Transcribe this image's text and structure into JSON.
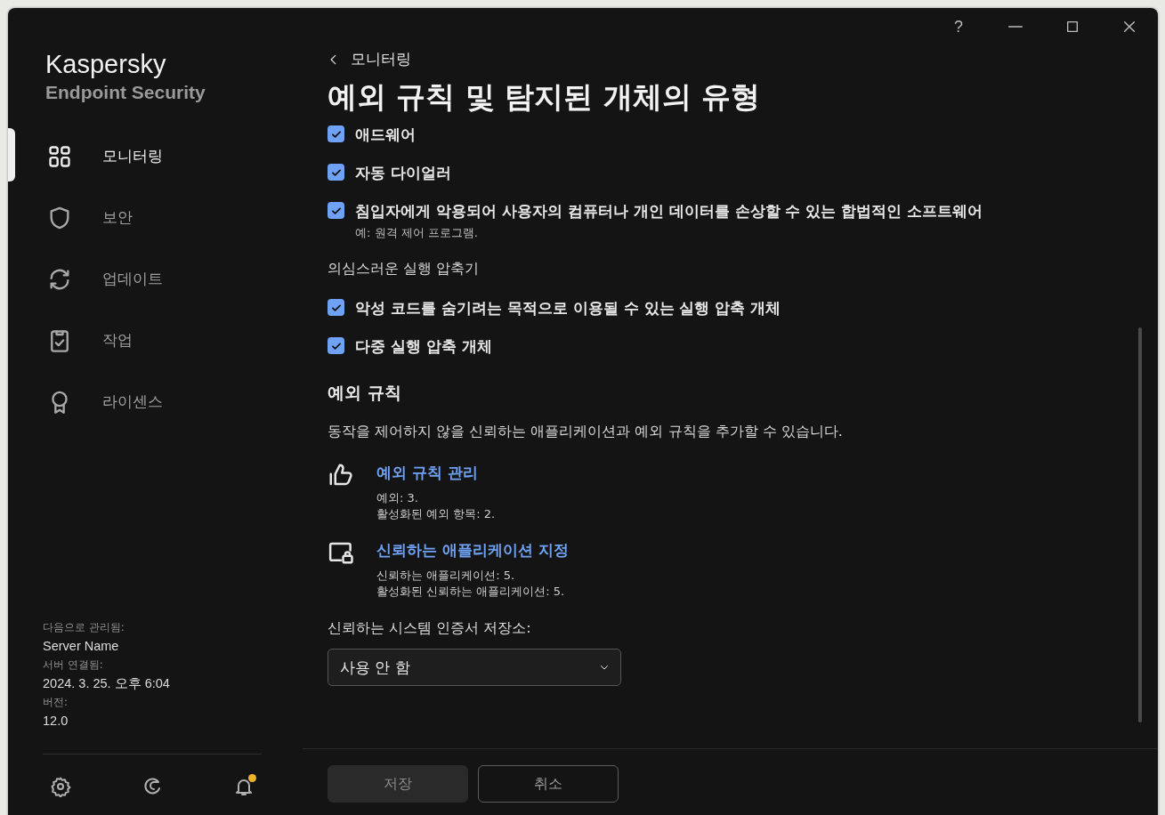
{
  "window": {
    "help": "?"
  },
  "sidebar": {
    "brand": {
      "name": "Kaspersky",
      "product": "Endpoint Security"
    },
    "items": [
      {
        "label": "모니터링",
        "selected": true
      },
      {
        "label": "보안",
        "selected": false
      },
      {
        "label": "업데이트",
        "selected": false
      },
      {
        "label": "작업",
        "selected": false
      },
      {
        "label": "라이센스",
        "selected": false
      }
    ],
    "info": [
      {
        "label": "다음으로 관리됨:",
        "value": "Server Name"
      },
      {
        "label": "서버 연결됨:",
        "value": "2024. 3. 25. 오후 6:04"
      },
      {
        "label": "버전:",
        "value": "12.0"
      }
    ],
    "notifications": {
      "unread": true
    }
  },
  "header": {
    "back": "모니터링",
    "title": "예외 규칙 및 탐지된 개체의 유형"
  },
  "content": [
    {
      "kind": "checkbox",
      "label": "애드웨어",
      "checked": true
    },
    {
      "kind": "checkbox",
      "label": "자동 다이얼러",
      "checked": true
    },
    {
      "kind": "checkbox",
      "label": "침입자에게 악용되어 사용자의 컴퓨터나 개인 데이터를 손상할 수 있는 합법적인 소프트웨어",
      "checked": true,
      "note": "예: 원격 제어 프로그램."
    },
    {
      "kind": "group",
      "label": "의심스러운 실행 압축기"
    },
    {
      "kind": "checkbox",
      "label": "악성 코드를 숨기려는 목적으로 이용될 수 있는 실행 압축 개체",
      "checked": true
    },
    {
      "kind": "checkbox",
      "label": "다중 실행 압축 개체",
      "checked": true
    },
    {
      "kind": "section",
      "label": "예외 규칙"
    },
    {
      "kind": "text",
      "label": "동작을 제어하지 않을 신뢰하는 애플리케이션과 예외 규칙을 추가할 수 있습니다."
    },
    {
      "kind": "link",
      "label": "예외 규칙 관리",
      "lines": [
        "예외: 3.",
        "활성화된 예외 항목: 2."
      ]
    },
    {
      "kind": "link",
      "label": "신뢰하는 애플리케이션 지정",
      "lines": [
        "신뢰하는 애플리케이션: 5.",
        "활성화된 신뢰하는 애플리케이션: 5."
      ]
    },
    {
      "kind": "select",
      "label": "신뢰하는 시스템 인증서 저장소:",
      "value": "사용 안 함"
    }
  ],
  "buttons": [
    {
      "label": "저장",
      "disabled": true
    },
    {
      "label": "취소",
      "disabled": false
    }
  ]
}
